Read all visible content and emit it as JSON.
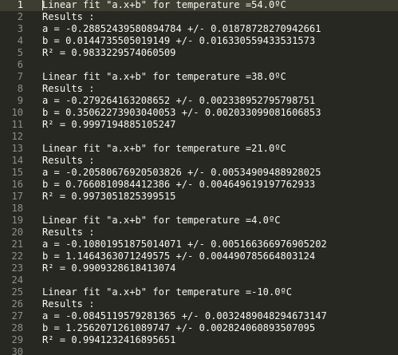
{
  "editor": {
    "current_line": 1,
    "lines": [
      "Linear fit \"a.x+b\" for temperature =54.0ºC",
      "Results :",
      "a = -0.28852439580894784 +/- 0.01878728270942661",
      "b = 0.0144735505019149 +/- 0.016330559433531573",
      "R² = 0.9833229574060509",
      "",
      "Linear fit \"a.x+b\" for temperature =38.0ºC",
      "Results :",
      "a = -0.279264163208652 +/- 0.002338952795798751",
      "b = 0.35062273903040053 +/- 0.002033099081606853",
      "R² = 0.9997194885105247",
      "",
      "Linear fit \"a.x+b\" for temperature =21.0ºC",
      "Results :",
      "a = -0.20580676920503826 +/- 0.00534909488928025",
      "b = 0.7660810984412386 +/- 0.004649619197762933",
      "R² = 0.9973051825399515",
      "",
      "Linear fit \"a.x+b\" for temperature =4.0ºC",
      "Results :",
      "a = -0.10801951875014071 +/- 0.005166366976905202",
      "b = 1.1464363071249575 +/- 0.004490785664803124",
      "R² = 0.9909328618413074",
      "",
      "Linear fit \"a.x+b\" for temperature =-10.0ºC",
      "Results :",
      "a = -0.0845119579281365 +/- 0.0032489048294673147",
      "b = 1.2562071261089747 +/- 0.002824060893507095",
      "R² = 0.9941232416895651",
      ""
    ]
  }
}
